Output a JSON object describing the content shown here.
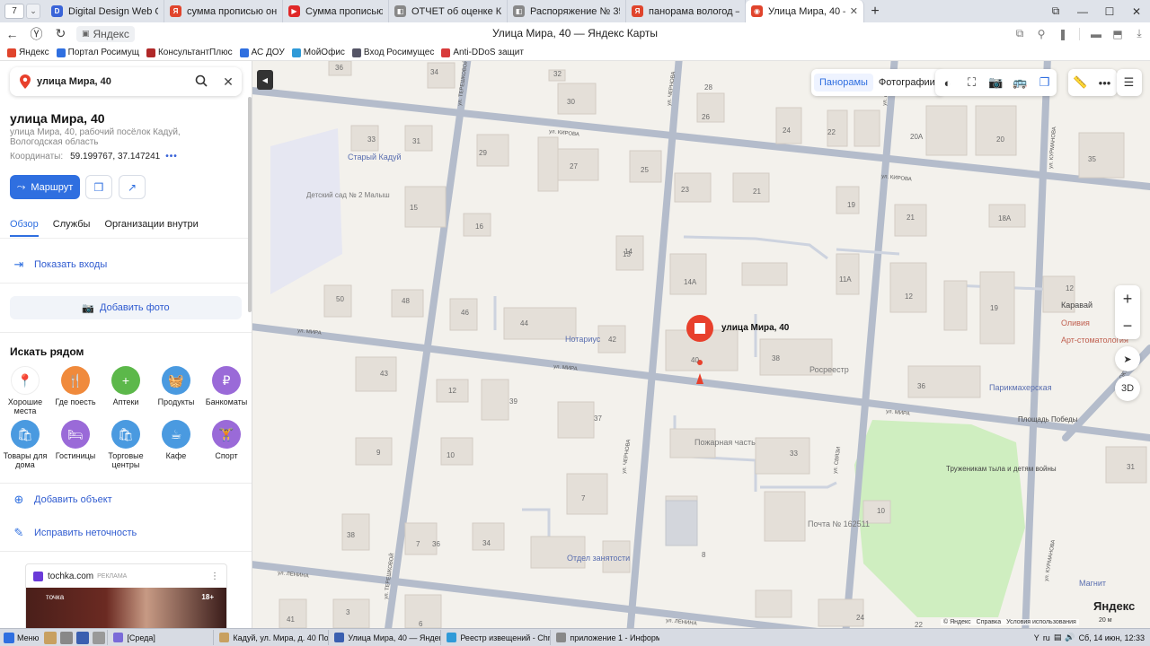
{
  "browser": {
    "tab_count": "7",
    "tabs": [
      {
        "label": "Digital Design Web Client",
        "fav_color": "#3a64d8",
        "fav": "D"
      },
      {
        "label": "сумма прописью онлайн",
        "fav_color": "#e0442c",
        "fav": "Я"
      },
      {
        "label": "Сумма прописью онлайн",
        "fav_color": "#e02828",
        "fav": "▶"
      },
      {
        "label": "ОТЧЕТ об оценке Кадуй.",
        "fav_color": "#888888",
        "fav": "◧"
      },
      {
        "label": "Распоряжение № 35-316",
        "fav_color": "#888888",
        "fav": "◧"
      },
      {
        "label": "панорама вологод — Янд",
        "fav_color": "#e0442c",
        "fav": "Я"
      },
      {
        "label": "Улица Мира, 40 — Янде",
        "fav_color": "#e0442c",
        "fav": "◉"
      }
    ],
    "site_name": "Яндекс",
    "page_title": "Улица Мира, 40 — Яндекс Карты",
    "bookmarks": [
      {
        "label": "Яндекс",
        "color": "#e0442c"
      },
      {
        "label": "Портал Росимущ",
        "color": "#2f6fe0"
      },
      {
        "label": "КонсультантПлюс",
        "color": "#b02828"
      },
      {
        "label": "АС ДОУ",
        "color": "#2f6fe0"
      },
      {
        "label": "МойОфис",
        "color": "#2f9ad8"
      },
      {
        "label": "Вход Росимущес",
        "color": "#556"
      },
      {
        "label": "Anti-DDoS защит",
        "color": "#d83a3a"
      }
    ]
  },
  "sidebar": {
    "search_value": "улица Мира, 40",
    "title": "улица Мира, 40",
    "subtitle": "улица Мира, 40, рабочий посёлок Кадуй, Вологодская область",
    "coords_label": "Координаты:",
    "coords_value": "59.199767, 37.147241",
    "coords_more": "•••",
    "route_label": "Маршрут",
    "tabs": [
      "Обзор",
      "Службы",
      "Организации внутри"
    ],
    "show_entrances": "Показать входы",
    "add_photo": "Добавить фото",
    "nearby_title": "Искать рядом",
    "categories": [
      {
        "label": "Хорошие места",
        "color": "#ffffff",
        "icon": "📍"
      },
      {
        "label": "Где поесть",
        "color": "#f08a3c",
        "icon": "🍴"
      },
      {
        "label": "Аптеки",
        "color": "#5cb84a",
        "icon": "+"
      },
      {
        "label": "Продукты",
        "color": "#4a9ae0",
        "icon": "🧺"
      },
      {
        "label": "Банкоматы",
        "color": "#9a6ad8",
        "icon": "₽"
      },
      {
        "label": "Товары для дома",
        "color": "#4a9ae0",
        "icon": "🛍"
      },
      {
        "label": "Гостиницы",
        "color": "#9a6ad8",
        "icon": "🛏"
      },
      {
        "label": "Торговые центры",
        "color": "#4a9ae0",
        "icon": "🛍"
      },
      {
        "label": "Кафе",
        "color": "#4a9ae0",
        "icon": "☕"
      },
      {
        "label": "Спорт",
        "color": "#9a6ad8",
        "icon": "🏋"
      }
    ],
    "add_object": "Добавить объект",
    "fix_error": "Исправить неточность",
    "ad": {
      "domain": "tochka.com",
      "tag": "РЕКЛАМА",
      "brand": "точка",
      "age": "18+"
    }
  },
  "map": {
    "layers": {
      "panoramas": "Панорамы",
      "photos": "Фотографии"
    },
    "marker_label": "улица Мира, 40",
    "btn_3d": "3D",
    "logo": "Яндекс",
    "copyright": [
      "© Яндекс",
      "Справка",
      "Условия использования"
    ],
    "scale": "20 м",
    "street_labels": [
      "ул. КИРОВА",
      "ул. КИРОВА",
      "ул. МИРА",
      "ул. МИРА",
      "ул. МИРА",
      "ул. ЛЕНИНА",
      "ул. ЛЕНИНА",
      "ул. ТЕРЕШКОВОЙ",
      "ул. ТЕРЕШКОВОЙ",
      "ул. ЧЕРНОВА",
      "ул. ЧЕРНОВА",
      "ул. СВЯЗИ",
      "ул. СВЯЗИ",
      "ул. КУРМАНОВА",
      "ул. КУРМАНОВА",
      "ОКТ"
    ],
    "pois": [
      "Старый Кадуй",
      "Детский сад № 2 Малыш",
      "Нотариус",
      "Росреестр",
      "Пожарная часть",
      "Почта № 162511",
      "Отдел занятости",
      "Парикмахерская",
      "Площадь Победы",
      "Труженикам тыла и детям войны",
      "Каравай",
      "Оливия",
      "Арт-стоматология",
      "Магнит"
    ],
    "house_numbers": [
      "36",
      "34",
      "32",
      "30",
      "28",
      "26",
      "24",
      "22",
      "20А",
      "20",
      "35",
      "33",
      "31",
      "29",
      "27",
      "25",
      "23",
      "21",
      "19",
      "21",
      "18А",
      "15",
      "16",
      "14",
      "13",
      "14А",
      "11А",
      "12",
      "19",
      "12",
      "50",
      "48",
      "46",
      "44",
      "42",
      "40",
      "38",
      "36",
      "43",
      "12",
      "39",
      "37",
      "9",
      "10",
      "7",
      "33",
      "10",
      "38",
      "7",
      "36",
      "34",
      "8",
      "6",
      "41",
      "3",
      "24",
      "22",
      "31"
    ]
  },
  "taskbar": {
    "start": "Меню",
    "tasks": [
      "[Среда]",
      "Кадуй, ул. Мира, д. 40 По...",
      "Улица Мира, 40 — Яндек...",
      "Реестр извещений - Chro...",
      "приложение 1 - Информ. ..."
    ],
    "clock": "Сб, 14 июн, 12:33",
    "lang": "ru"
  }
}
